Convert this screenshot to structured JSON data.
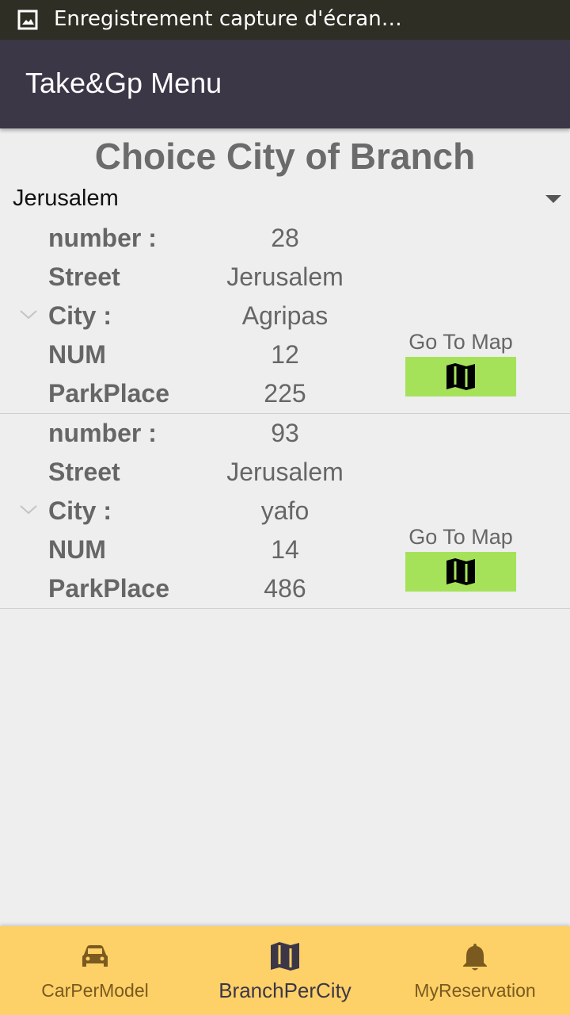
{
  "status_bar": {
    "notification_text": "Enregistrement capture d'écran…",
    "icon": "image-icon"
  },
  "app_bar": {
    "title": "Take&Gp Menu"
  },
  "heading": "Choice City of Branch",
  "city_spinner": {
    "selected": "Jerusalem"
  },
  "field_labels": {
    "number": "number :",
    "street": "Street",
    "city": "City :",
    "num": "NUM",
    "park_place": "ParkPlace"
  },
  "branches": [
    {
      "number": "28",
      "street": "Jerusalem",
      "city": "Agripas",
      "num": "12",
      "park_place": "225",
      "map_label": "Go To Map",
      "map_icon": "map-icon"
    },
    {
      "number": "93",
      "street": "Jerusalem",
      "city": "yafo",
      "num": "14",
      "park_place": "486",
      "map_label": "Go To Map",
      "map_icon": "map-icon"
    }
  ],
  "bottom_nav": [
    {
      "label": "CarPerModel",
      "icon": "car-icon",
      "active": false
    },
    {
      "label": "BranchPerCity",
      "icon": "map-icon",
      "active": true
    },
    {
      "label": "MyReservation",
      "icon": "bell-icon",
      "active": false
    }
  ],
  "colors": {
    "app_bar": "#3b3747",
    "status_bar": "#2e2e24",
    "map_button": "#a5e25a",
    "bottom_nav": "#fdd068",
    "background": "#eeeeee"
  }
}
